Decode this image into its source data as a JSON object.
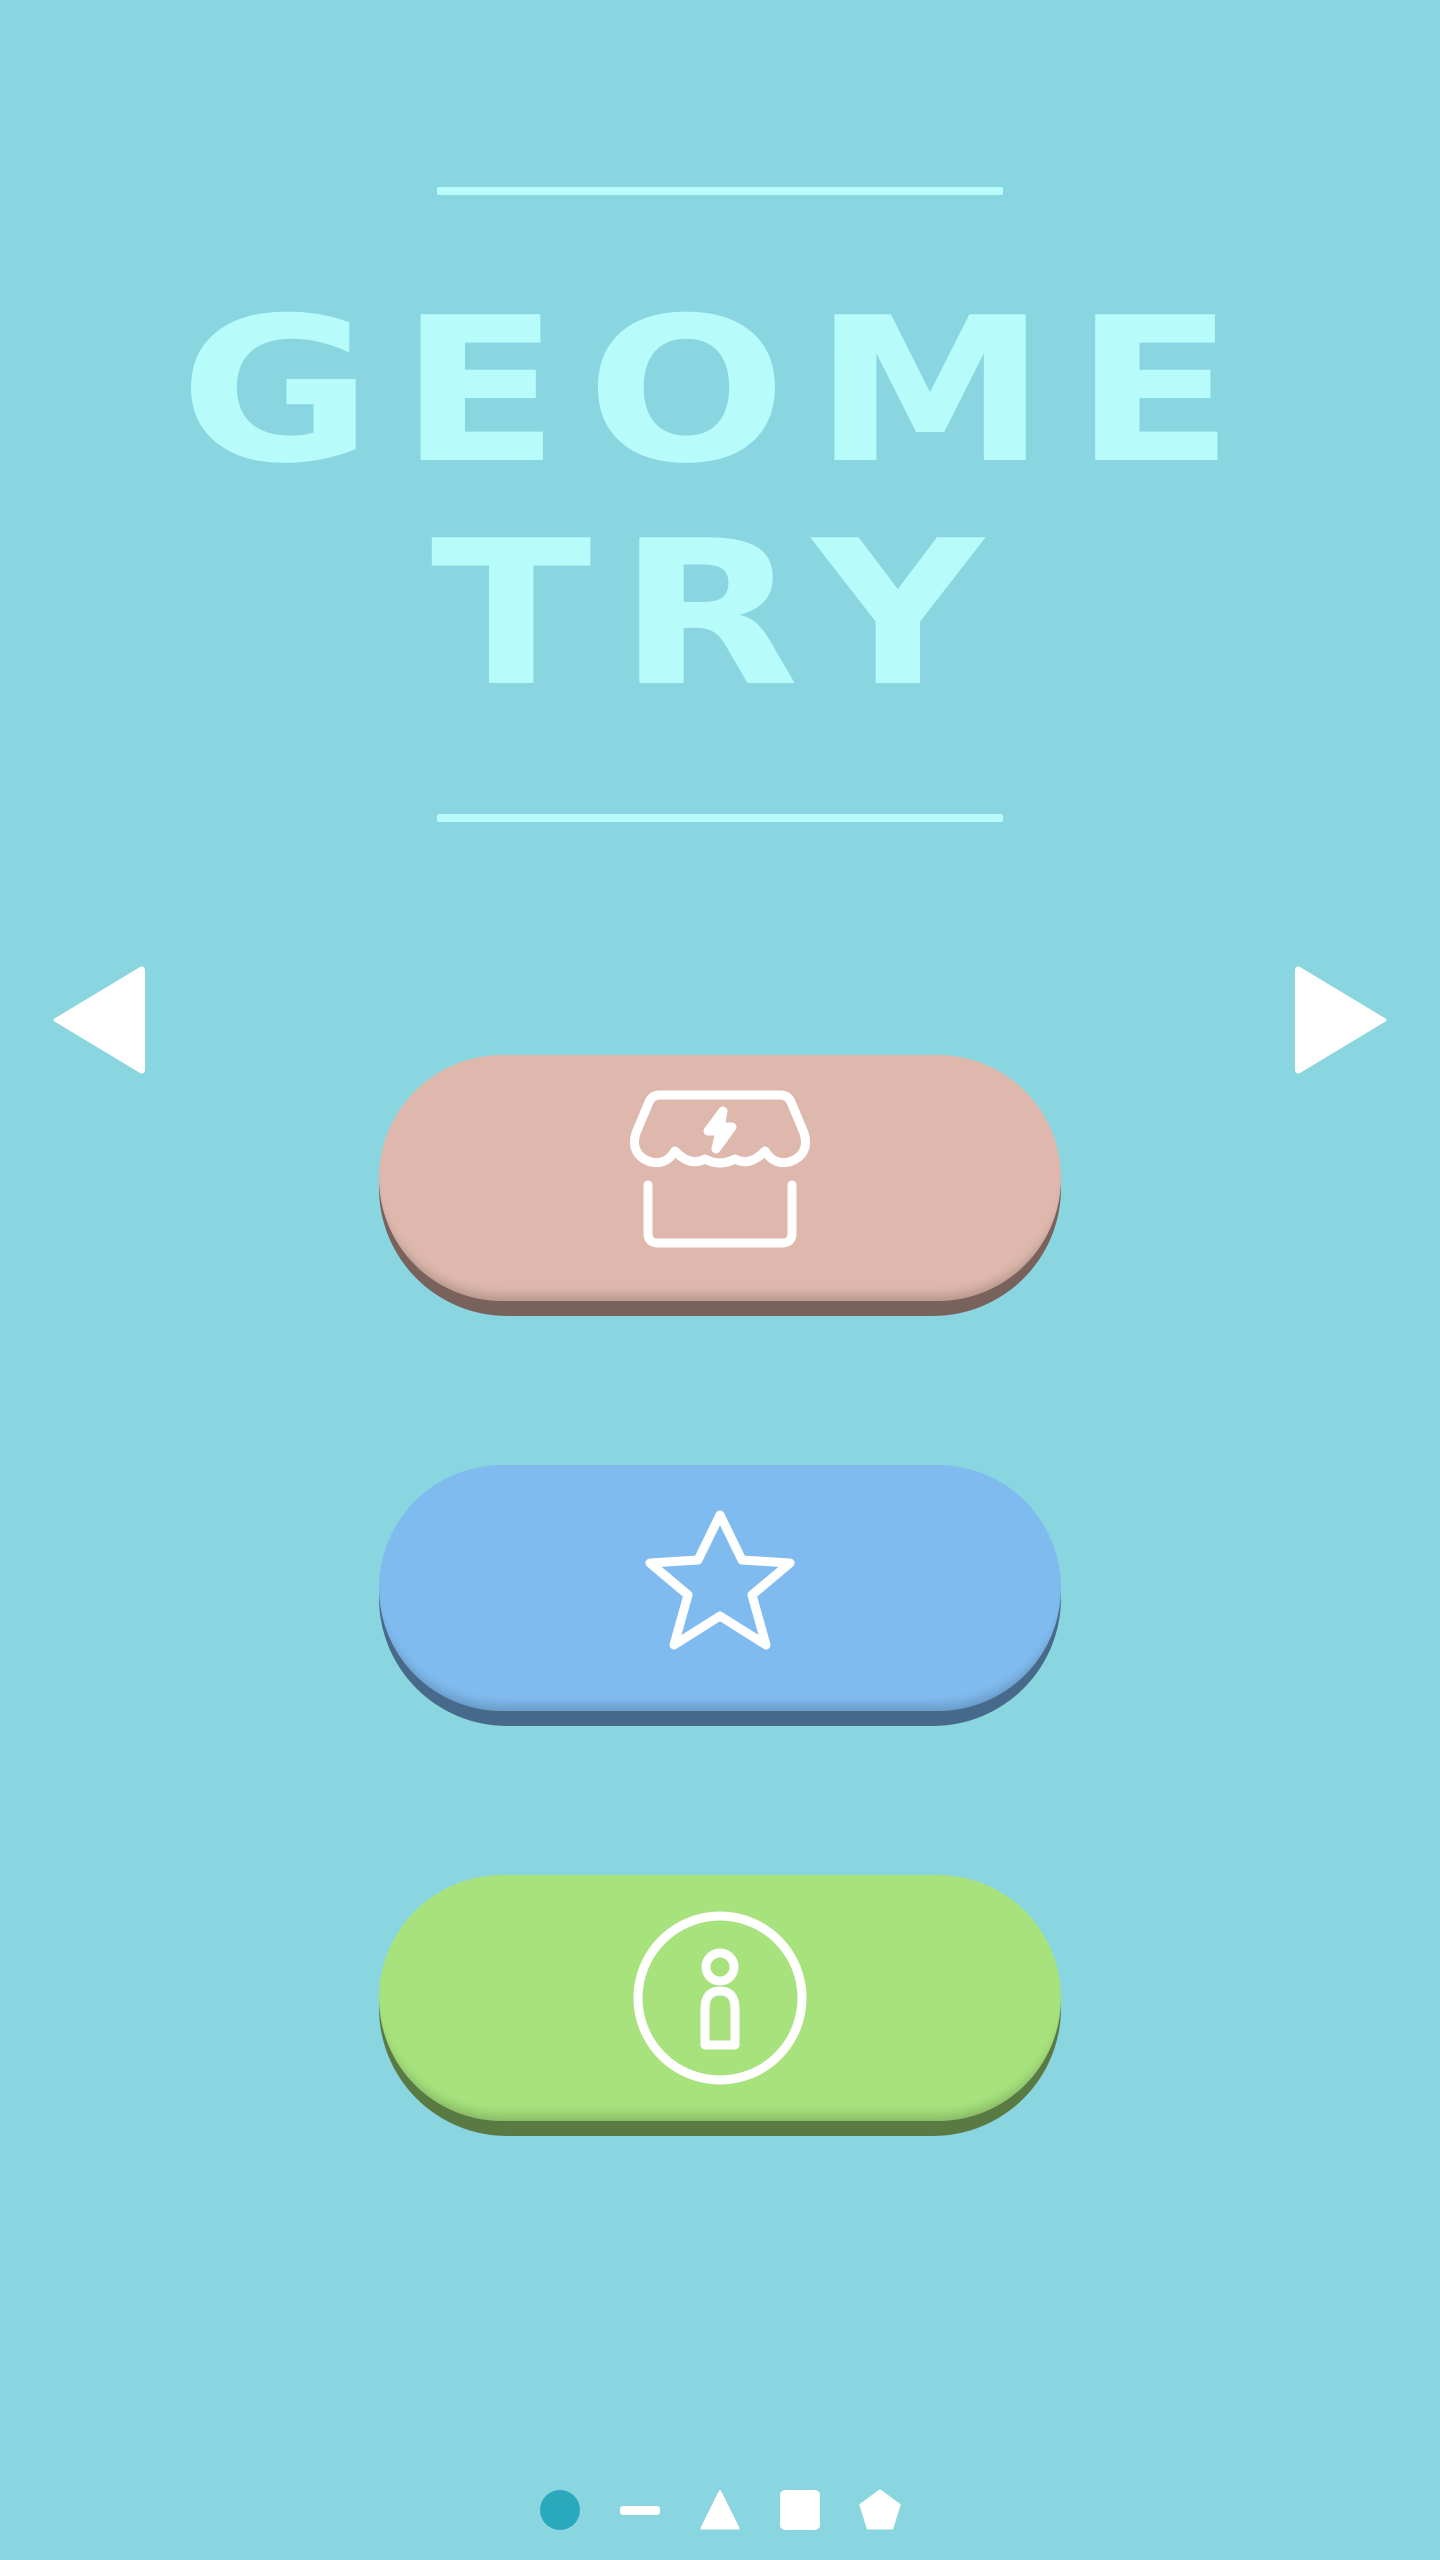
{
  "title": {
    "line1": "GEOME",
    "line2": "TRY"
  },
  "colors": {
    "background": "#89d5e0",
    "title": "#b7fbfb",
    "shop_button": "#deb8ad",
    "shop_shadow": "#7a625c",
    "favorites_button": "#80bbef",
    "favorites_shadow": "#486a8a",
    "profile_button": "#a7e27d",
    "profile_shadow": "#5a7a44",
    "active_dot": "#2aa9bc",
    "icon": "#ffffff"
  },
  "nav": {
    "prev_icon": "triangle-left-icon",
    "next_icon": "triangle-right-icon"
  },
  "menu": [
    {
      "id": "shop",
      "icon": "store-bolt-icon"
    },
    {
      "id": "favorites",
      "icon": "star-icon"
    },
    {
      "id": "profile",
      "icon": "user-circle-icon"
    }
  ],
  "page_indicator": {
    "items": [
      "circle",
      "line",
      "triangle",
      "square",
      "pentagon"
    ],
    "active_index": 0
  }
}
